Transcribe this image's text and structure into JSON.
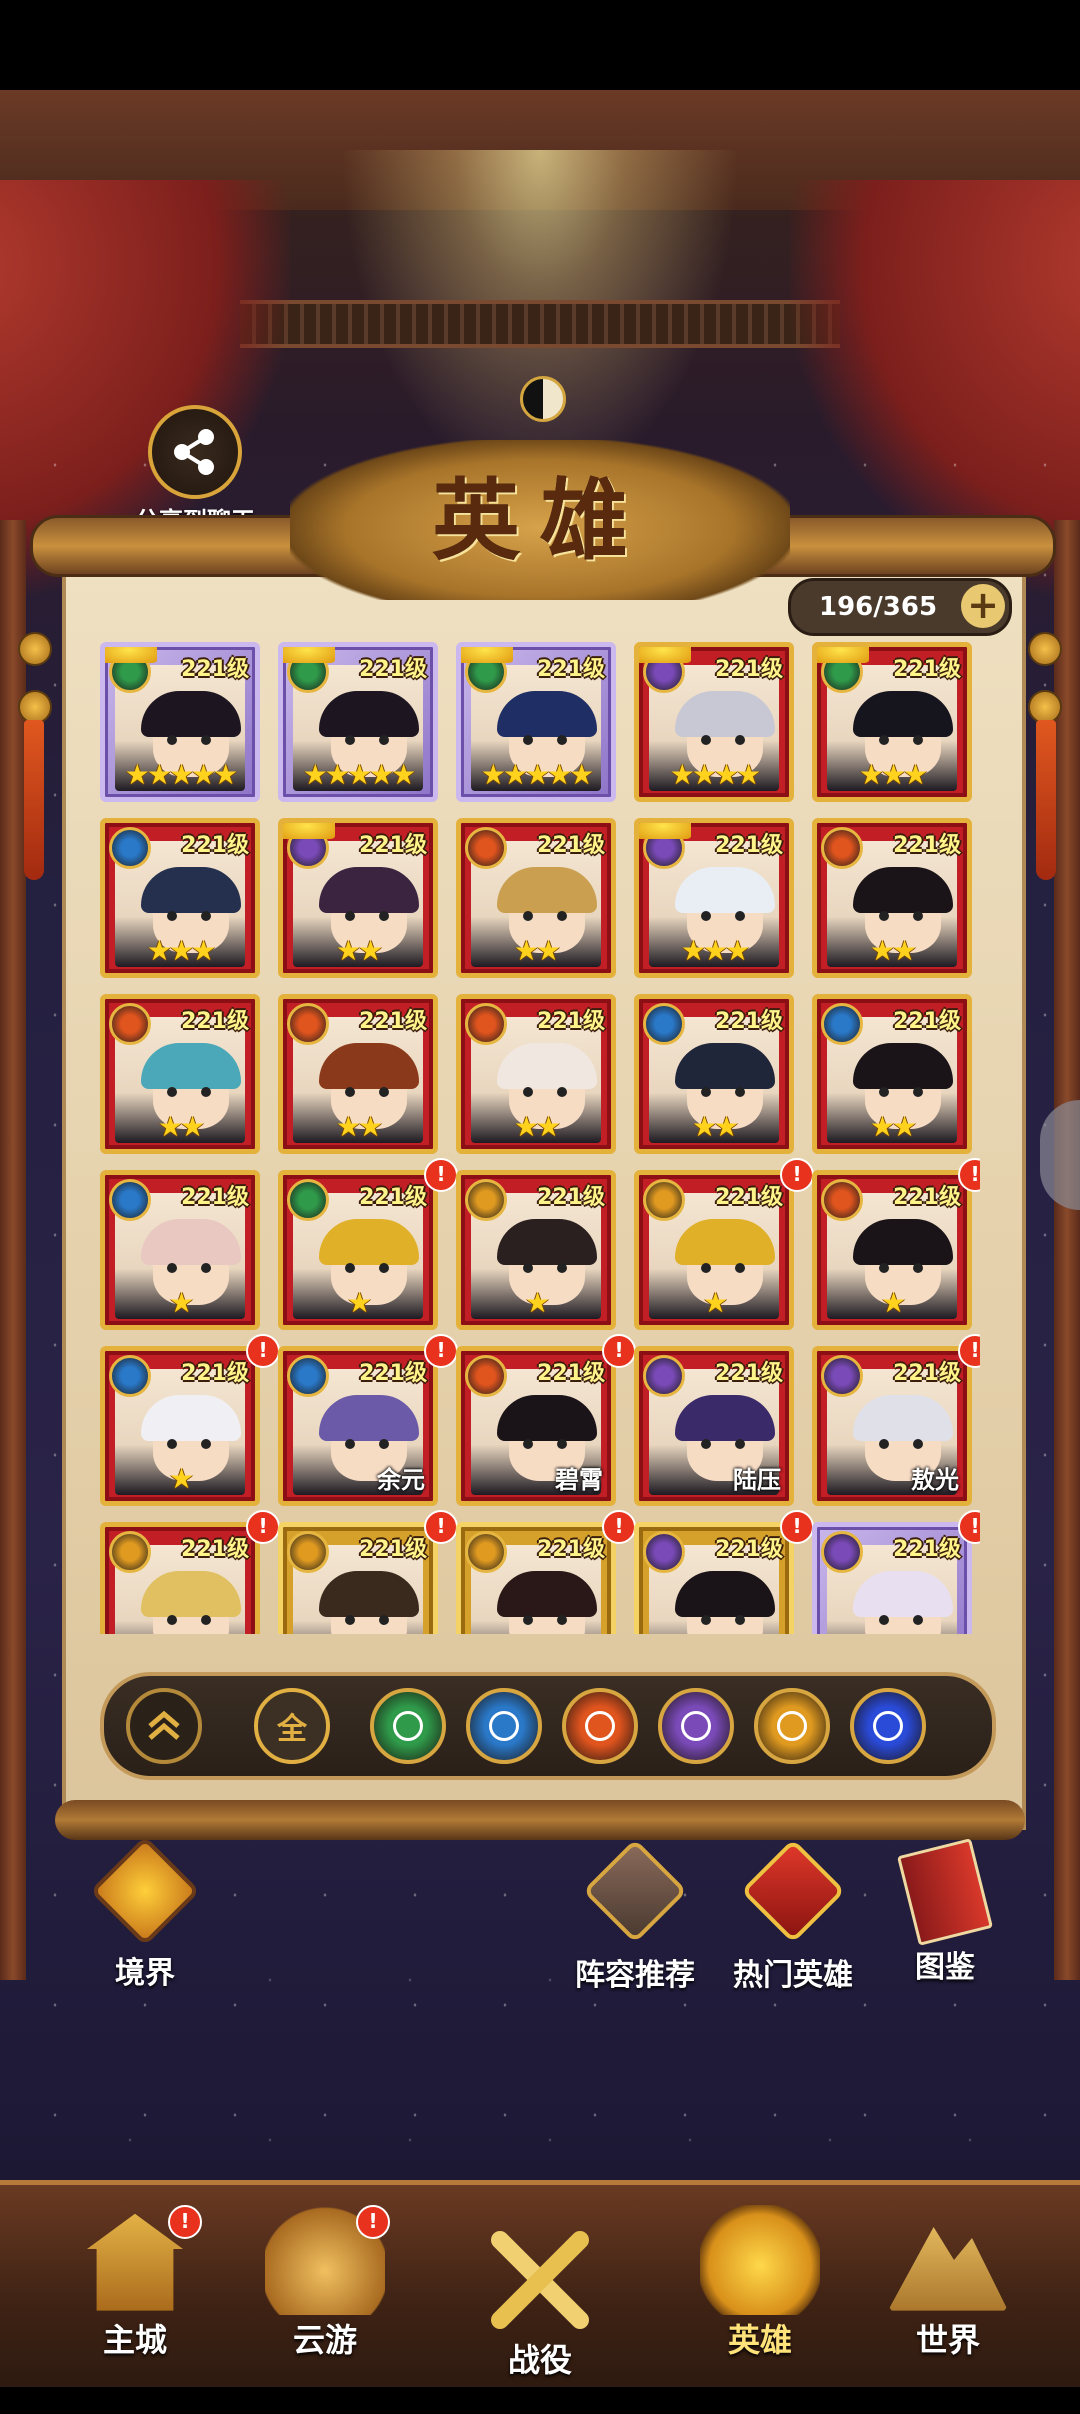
{
  "share": {
    "label": "分享到聊天"
  },
  "title": "英雄",
  "collection": {
    "count": "196/365"
  },
  "heroes": [
    {
      "level": "221级",
      "stars": "★★★★★",
      "frame": "purple",
      "element": "leaf",
      "elem_color": "#2f9a4a",
      "crown": true,
      "name": "",
      "alert": false,
      "hair": "#1d1620"
    },
    {
      "level": "221级",
      "stars": "★★★★★",
      "frame": "purple",
      "element": "leaf",
      "elem_color": "#2f9a4a",
      "crown": true,
      "name": "",
      "alert": false,
      "hair": "#1d1620"
    },
    {
      "level": "221级",
      "stars": "★★★★★",
      "frame": "purple",
      "element": "leaf",
      "elem_color": "#2f9a4a",
      "crown": true,
      "name": "",
      "alert": false,
      "hair": "#1f2f66"
    },
    {
      "level": "221级",
      "stars": "★★★★",
      "frame": "red",
      "element": "moon",
      "elem_color": "#7a4ab8",
      "crown": true,
      "name": "",
      "alert": false,
      "hair": "#c8c8d4"
    },
    {
      "level": "221级",
      "stars": "★★★",
      "frame": "red",
      "element": "leaf",
      "elem_color": "#2f9a4a",
      "crown": true,
      "name": "",
      "alert": false,
      "hair": "#16141c"
    },
    {
      "level": "221级",
      "stars": "★★★",
      "frame": "red",
      "element": "water",
      "elem_color": "#2a78c8",
      "crown": false,
      "name": "",
      "alert": false,
      "hair": "#24304e"
    },
    {
      "level": "221级",
      "stars": "★★",
      "frame": "red",
      "element": "moon",
      "elem_color": "#7a4ab8",
      "crown": true,
      "name": "",
      "alert": false,
      "hair": "#3a2440"
    },
    {
      "level": "221级",
      "stars": "★★",
      "frame": "red",
      "element": "fire",
      "elem_color": "#e0541e",
      "crown": false,
      "name": "",
      "alert": false,
      "hair": "#caa050"
    },
    {
      "level": "221级",
      "stars": "★★★",
      "frame": "red",
      "element": "moon",
      "elem_color": "#7a4ab8",
      "crown": true,
      "name": "",
      "alert": false,
      "hair": "#e8eef4"
    },
    {
      "level": "221级",
      "stars": "★★",
      "frame": "red",
      "element": "fire",
      "elem_color": "#e0541e",
      "crown": false,
      "name": "",
      "alert": false,
      "hair": "#1a1418"
    },
    {
      "level": "221级",
      "stars": "★★",
      "frame": "red",
      "element": "fire",
      "elem_color": "#e0541e",
      "crown": false,
      "name": "",
      "alert": false,
      "hair": "#4aa8b8"
    },
    {
      "level": "221级",
      "stars": "★★",
      "frame": "red",
      "element": "fire",
      "elem_color": "#e0541e",
      "crown": false,
      "name": "",
      "alert": false,
      "hair": "#8a3a1a"
    },
    {
      "level": "221级",
      "stars": "★★",
      "frame": "red",
      "element": "fire",
      "elem_color": "#e0541e",
      "crown": false,
      "name": "",
      "alert": false,
      "hair": "#f0e8e0"
    },
    {
      "level": "221级",
      "stars": "★★",
      "frame": "red",
      "element": "water",
      "elem_color": "#2a78c8",
      "crown": false,
      "name": "",
      "alert": false,
      "hair": "#20263a"
    },
    {
      "level": "221级",
      "stars": "★★",
      "frame": "red",
      "element": "water",
      "elem_color": "#2a78c8",
      "crown": false,
      "name": "",
      "alert": false,
      "hair": "#1a1418"
    },
    {
      "level": "221级",
      "stars": "★",
      "frame": "red",
      "element": "water",
      "elem_color": "#2a78c8",
      "crown": false,
      "name": "",
      "alert": false,
      "hair": "#e8c8c0"
    },
    {
      "level": "221级",
      "stars": "★",
      "frame": "red",
      "element": "leaf",
      "elem_color": "#2f9a4a",
      "crown": false,
      "name": "",
      "alert": true,
      "hair": "#e0b028"
    },
    {
      "level": "221级",
      "stars": "★",
      "frame": "red",
      "element": "sun",
      "elem_color": "#e09a20",
      "crown": false,
      "name": "",
      "alert": false,
      "hair": "#2a2020"
    },
    {
      "level": "221级",
      "stars": "★",
      "frame": "red",
      "element": "sun",
      "elem_color": "#e09a20",
      "crown": false,
      "name": "",
      "alert": true,
      "hair": "#e0b028"
    },
    {
      "level": "221级",
      "stars": "★",
      "frame": "red",
      "element": "fire",
      "elem_color": "#e0541e",
      "crown": false,
      "name": "",
      "alert": true,
      "hair": "#1a1418"
    },
    {
      "level": "221级",
      "stars": "★",
      "frame": "red",
      "element": "water",
      "elem_color": "#2a78c8",
      "crown": false,
      "name": "",
      "alert": true,
      "hair": "#f0f0f4"
    },
    {
      "level": "221级",
      "stars": "",
      "frame": "red",
      "element": "water",
      "elem_color": "#2a78c8",
      "crown": false,
      "name": "余元",
      "alert": true,
      "hair": "#6a5aa8"
    },
    {
      "level": "221级",
      "stars": "",
      "frame": "red",
      "element": "fire",
      "elem_color": "#e0541e",
      "crown": false,
      "name": "碧霄",
      "alert": true,
      "hair": "#1a1418"
    },
    {
      "level": "221级",
      "stars": "",
      "frame": "red",
      "element": "moon",
      "elem_color": "#7a4ab8",
      "crown": false,
      "name": "陆压",
      "alert": false,
      "hair": "#3a2a6a"
    },
    {
      "level": "221级",
      "stars": "",
      "frame": "red",
      "element": "moon",
      "elem_color": "#7a4ab8",
      "crown": false,
      "name": "敖光",
      "alert": true,
      "hair": "#e0e0e8"
    },
    {
      "level": "221级",
      "stars": "",
      "frame": "red",
      "element": "sun",
      "elem_color": "#e09a20",
      "crown": false,
      "name": "",
      "alert": true,
      "hair": "#e0c060"
    },
    {
      "level": "221级",
      "stars": "",
      "frame": "gold",
      "element": "sun",
      "elem_color": "#e09a20",
      "crown": false,
      "name": "",
      "alert": true,
      "hair": "#3a2a1e"
    },
    {
      "level": "221级",
      "stars": "",
      "frame": "gold",
      "element": "sun",
      "elem_color": "#e09a20",
      "crown": false,
      "name": "",
      "alert": true,
      "hair": "#2a1818"
    },
    {
      "level": "221级",
      "stars": "",
      "frame": "gold",
      "element": "moon",
      "elem_color": "#7a4ab8",
      "crown": false,
      "name": "",
      "alert": true,
      "hair": "#1a1418"
    },
    {
      "level": "221级",
      "stars": "",
      "frame": "purple",
      "element": "moon",
      "elem_color": "#7a4ab8",
      "crown": false,
      "name": "",
      "alert": true,
      "hair": "#e8e0f0"
    }
  ],
  "filters": {
    "all_label": "全",
    "elements": [
      {
        "name": "leaf",
        "color": "#2f9a4a"
      },
      {
        "name": "water",
        "color": "#2a78c8"
      },
      {
        "name": "fire",
        "color": "#e0541e"
      },
      {
        "name": "moon",
        "color": "#7a4ab8"
      },
      {
        "name": "sun",
        "color": "#e09a20"
      },
      {
        "name": "vortex",
        "color": "#2a4ad8"
      }
    ]
  },
  "features": {
    "realm": "境界",
    "lineup": "阵容推荐",
    "hot": "热门英雄",
    "codex": "图鉴"
  },
  "nav": {
    "city": "主城",
    "travel": "云游",
    "battle": "战役",
    "hero": "英雄",
    "world": "世界"
  }
}
